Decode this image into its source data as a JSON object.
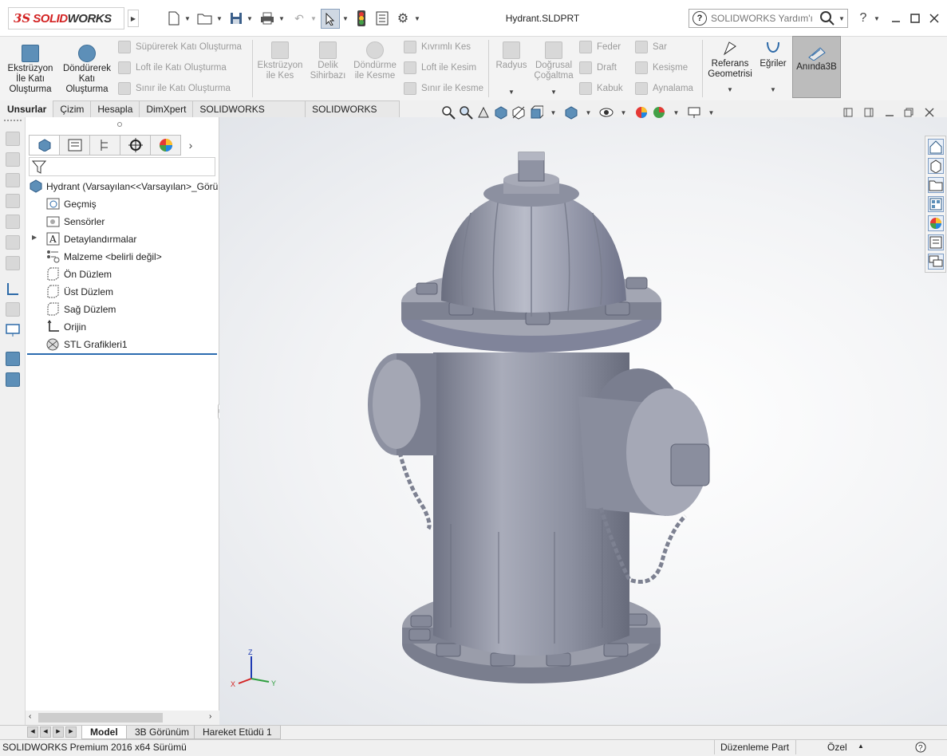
{
  "app": {
    "logo_ds": "3S",
    "logo_text_red": "SOLID",
    "logo_text_dark": "WORKS",
    "document_title": "Hydrant.SLDPRT"
  },
  "search": {
    "placeholder": "SOLIDWORKS Yardım'ı Ara",
    "help_glyph": "?"
  },
  "ribbon": {
    "extrude_boss": "Ekstrüzyon İle Katı Oluşturma",
    "revolve_boss": "Döndürerek Katı Oluşturma",
    "swept_boss": "Süpürerek Katı Oluşturma",
    "lofted_boss": "Loft ile Katı Oluşturma",
    "boundary_boss": "Sınır ile Katı Oluşturma",
    "extrude_cut": "Ekstrüzyon ile Kes",
    "hole_wizard": "Delik Sihirbazı",
    "revolve_cut": "Döndürme ile Kesme",
    "swept_cut": "Kıvrımlı Kes",
    "lofted_cut": "Loft ile Kesim",
    "boundary_cut": "Sınır ile Kesme",
    "fillet": "Radyus",
    "linear_pattern": "Doğrusal Çoğaltma",
    "rib": "Feder",
    "draft": "Draft",
    "shell": "Kabuk",
    "wrap": "Sar",
    "intersect": "Kesişme",
    "mirror": "Aynalama",
    "ref_geometry": "Referans Geometrisi",
    "curves": "Eğriler",
    "instant3d": "Anında3B"
  },
  "command_tabs": [
    "Unsurlar",
    "Çizim",
    "Hesapla",
    "DimXpert",
    "SOLIDWORKS Eklentileri",
    "SOLIDWORKS MBD"
  ],
  "feature_tree": {
    "root": "Hydrant  (Varsayılan<<Varsayılan>_Görü",
    "items": [
      "Geçmiş",
      "Sensörler",
      "Detaylandırmalar",
      "Malzeme <belirli değil>",
      "Ön Düzlem",
      "Üst Düzlem",
      "Sağ Düzlem",
      "Orijin",
      "STL Grafikleri1"
    ]
  },
  "triad": {
    "z": "Z",
    "x": "X",
    "y": "Y"
  },
  "bottom_tabs": [
    "Model",
    "3B Görünüm",
    "Hareket Etüdü 1"
  ],
  "status": {
    "version": "SOLIDWORKS Premium 2016 x64 Sürümü",
    "mode": "Düzenleme Part",
    "units": "Özel"
  },
  "colors": {
    "brand_red": "#d32323",
    "model_gray": "#8f93a3",
    "tree_underline": "#2b6cb0"
  }
}
